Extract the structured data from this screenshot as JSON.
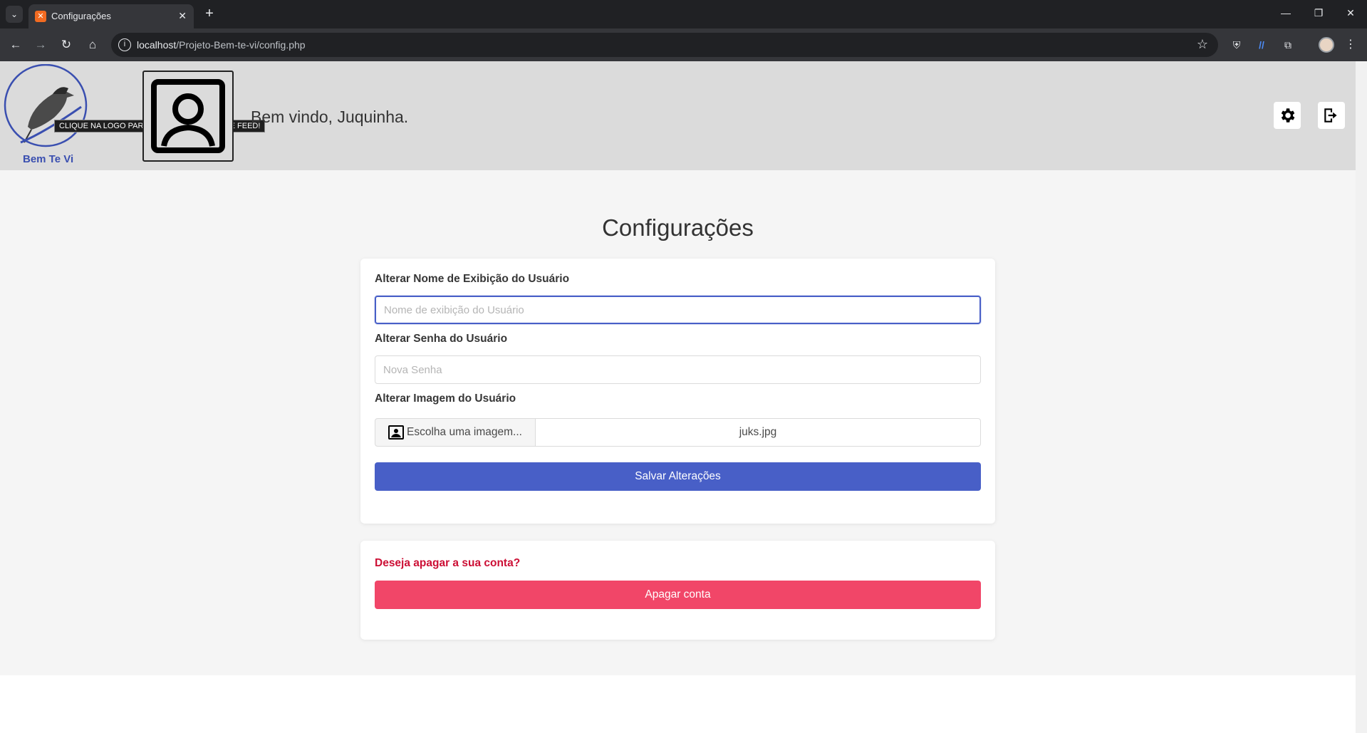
{
  "browser": {
    "tab_title": "Configurações",
    "url_host": "localhost",
    "url_path": "/Projeto-Bem-te-vi/config.php"
  },
  "header": {
    "logo_text": "Bem Te Vi",
    "tooltip": "CLIQUE NA LOGO PARA RETORNAR A TELA DE FEED!",
    "welcome": "Bem vindo, Juquinha."
  },
  "page": {
    "title": "Configurações"
  },
  "settings_form": {
    "display_name_label": "Alterar Nome de Exibição do Usuário",
    "display_name_placeholder": "Nome de exibição do Usuário",
    "password_label": "Alterar Senha do Usuário",
    "password_placeholder": "Nova Senha",
    "image_label": "Alterar Imagem do Usuário",
    "image_button": "Escolha uma imagem...",
    "image_filename": "juks.jpg",
    "save_button": "Salvar Alterações"
  },
  "delete_account": {
    "question": "Deseja apagar a sua conta?",
    "button": "Apagar conta"
  },
  "colors": {
    "primary": "#485fc7",
    "danger": "#f14668",
    "danger_text": "#cc0f35",
    "header_bg": "#dbdbdb"
  }
}
